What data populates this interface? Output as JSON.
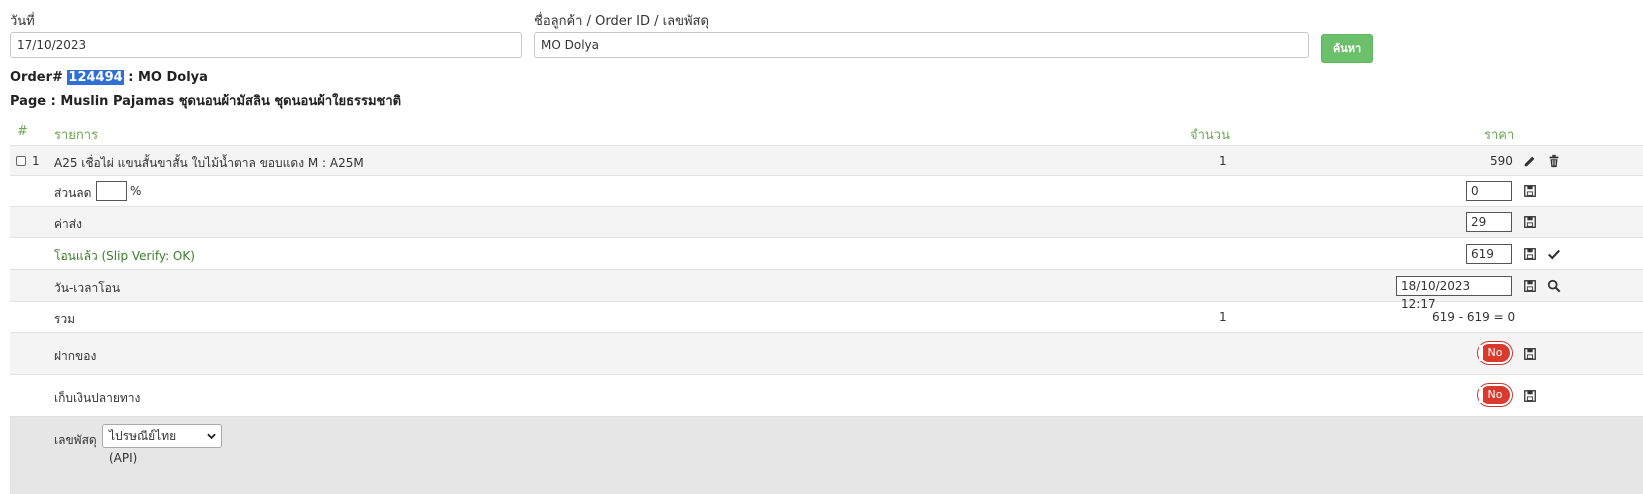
{
  "search": {
    "date_label": "วันที่",
    "date_value": "17/10/2023",
    "customer_label": "ชื่อลูกค้า / Order ID / เลขพัสดุ",
    "customer_value": "MO Dolya",
    "search_button": "ค้นหา"
  },
  "order": {
    "prefix": "Order#",
    "id": "124494",
    "customer": ": MO Dolya",
    "page_label": "Page : Muslin Pajamas ชุดนอนผ้ามัสลิน ชุดนอนผ้าใยธรรมชาติ"
  },
  "table": {
    "headers": {
      "index": "#",
      "item": "รายการ",
      "qty": "จำนวน",
      "price": "ราคา"
    },
    "item": {
      "index": "1",
      "name": "A25 เชื่อไผ่ แขนสั้นขาสั้น ใบไม้น้ำตาล ขอบแดง M : A25M",
      "qty": "1",
      "price": "590"
    },
    "discount": {
      "label": "ส่วนลด",
      "percent_value": "",
      "percent_sign": "%",
      "amount": "0"
    },
    "shipping": {
      "label": "ค่าส่ง",
      "amount": "29"
    },
    "transfer": {
      "label": "โอนแล้ว (Slip Verify: OK)",
      "amount": "619"
    },
    "transfer_time": {
      "label": "วัน-เวลาโอน",
      "value": "18/10/2023 12:17"
    },
    "total": {
      "label": "รวม",
      "qty": "1",
      "calc": "619 - 619 = 0"
    },
    "deposit": {
      "label": "ฝากของ",
      "toggle": "No"
    },
    "cod": {
      "label": "เก็บเงินปลายทาง",
      "toggle": "No"
    },
    "tracking": {
      "label": "เลขพัสดุ",
      "carrier": "ไปรษณีย์ไทย (API)"
    }
  },
  "colors": {
    "accent_green": "#6cc06c",
    "header_green": "#6aa84f",
    "toggle_red": "#d93a2e",
    "highlight_blue": "#2f6fd6"
  }
}
